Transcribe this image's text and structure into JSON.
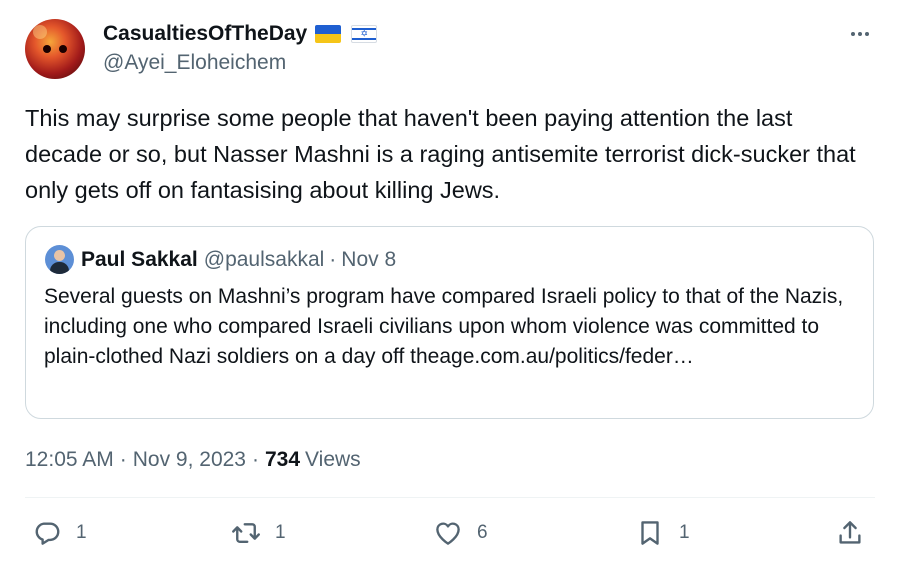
{
  "author": {
    "display_name": "CasualtiesOfTheDay",
    "handle": "@Ayei_Eloheichem",
    "flags": [
      "ukraine-flag",
      "israel-flag"
    ]
  },
  "tweet": {
    "text": "This may surprise some people that haven't been paying attention the last decade or so, but Nasser Mashni is a raging antisemite terrorist dick-sucker that only gets off on fantasising about killing Jews."
  },
  "quote": {
    "display_name": "Paul Sakkal",
    "handle": "@paulsakkal",
    "separator": "·",
    "date": "Nov 8",
    "text": "Several guests on Mashni’s program have compared Israeli policy to that of the Nazis, including one who compared Israeli civilians upon whom violence was committed to plain-clothed Nazi soldiers on a day off theage.com.au/politics/feder…"
  },
  "meta": {
    "time": "12:05 AM",
    "separator": "·",
    "date": "Nov 9, 2023",
    "views_count": "734",
    "views_label": "Views"
  },
  "actions": {
    "reply_count": "1",
    "retweet_count": "1",
    "like_count": "6",
    "bookmark_count": "1"
  },
  "colors": {
    "text": "#0f1419",
    "secondary": "#536471",
    "border": "#cfd9de"
  }
}
